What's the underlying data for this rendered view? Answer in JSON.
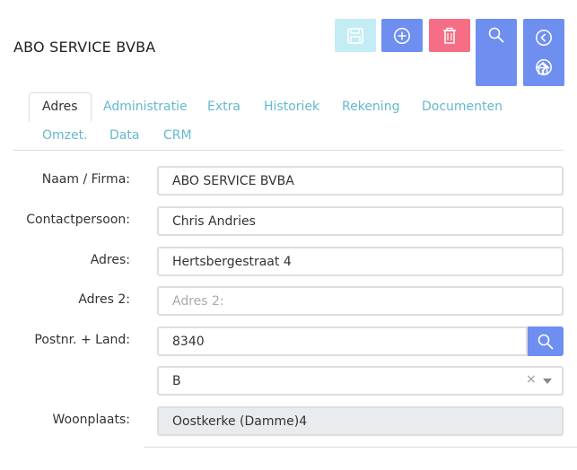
{
  "page": {
    "title": "ABO SERVICE BVBA"
  },
  "toolbar": {
    "save_icon": "save-icon",
    "add_icon": "plus-circle-icon",
    "delete_icon": "trash-icon",
    "search_icon": "search-icon",
    "prev_icon": "chevron-left-icon",
    "next_icon": "chevron-right-icon",
    "home_icon": "home-icon"
  },
  "tabs": [
    {
      "label": "Adres",
      "active": true
    },
    {
      "label": "Administratie"
    },
    {
      "label": "Extra"
    },
    {
      "label": "Historiek"
    },
    {
      "label": "Rekening"
    },
    {
      "label": "Documenten"
    },
    {
      "label": "Omzet."
    },
    {
      "label": "Data"
    },
    {
      "label": "CRM"
    }
  ],
  "form": {
    "naam": {
      "label": "Naam / Firma:",
      "value": "ABO SERVICE BVBA"
    },
    "contact": {
      "label": "Contactpersoon:",
      "value": "Chris Andries"
    },
    "adres": {
      "label": "Adres:",
      "value": "Hertsbergestraat 4"
    },
    "adres2": {
      "label": "Adres 2:",
      "placeholder": "Adres 2:"
    },
    "postnr": {
      "label": "Postnr. + Land:",
      "value": "8340"
    },
    "land": {
      "value": "B",
      "clear": "×"
    },
    "woonplaats": {
      "label": "Woonplaats:",
      "value": "Oostkerke (Damme)4"
    }
  },
  "colors": {
    "primary": "#6e8ff0",
    "danger": "#f56e85",
    "save_disabled": "#c3ecf5",
    "tab_link": "#64b8cf"
  }
}
